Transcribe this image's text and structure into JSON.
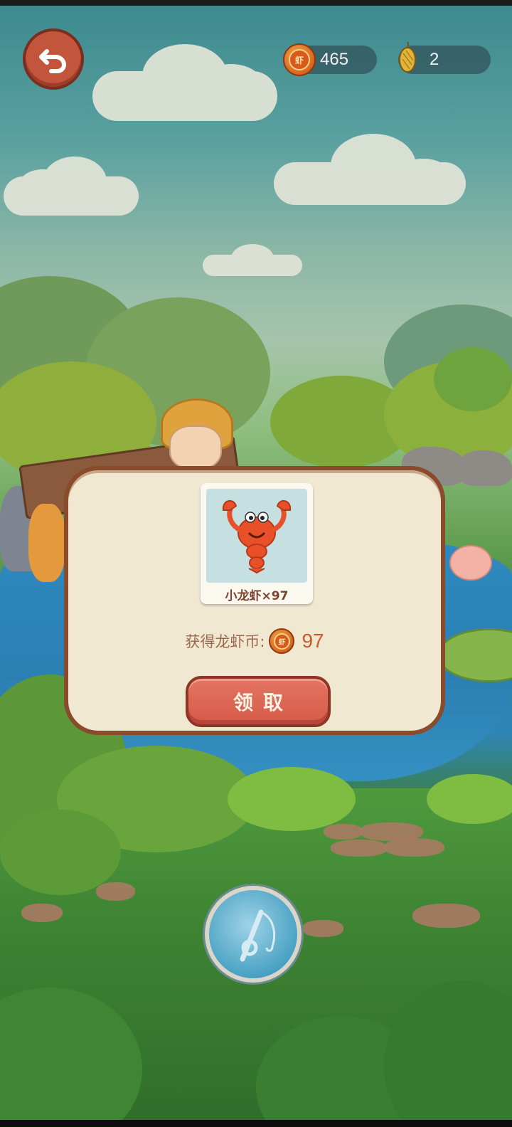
{
  "header": {
    "back_icon": "undo-arrow-icon",
    "coins": {
      "icon": "crayfish-coin-icon",
      "value": "465"
    },
    "bait": {
      "icon": "corn-bait-icon",
      "value": "2"
    }
  },
  "dialog": {
    "reward": {
      "icon": "crayfish-icon",
      "label": "小龙虾×97"
    },
    "earn_label": "获得龙虾币:",
    "earn_icon": "crayfish-coin-icon",
    "earn_value": "97",
    "claim_label": "领取"
  },
  "fishing_button": {
    "icon": "fishing-rod-icon"
  },
  "colors": {
    "accent": "#d65a48",
    "dialog_bg": "#f1e8d2",
    "dialog_border": "#8a4a2c"
  }
}
